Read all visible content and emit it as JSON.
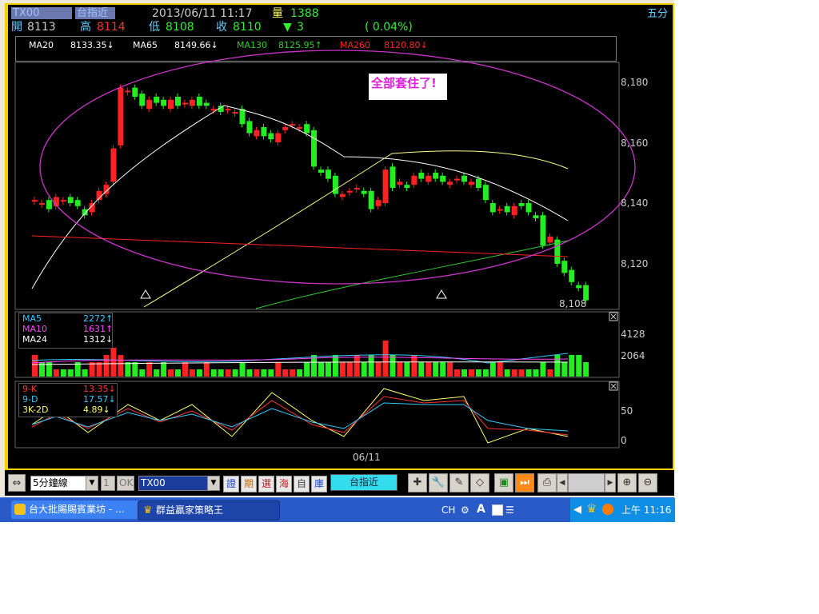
{
  "header": {
    "symbol": "TX00",
    "name": "台指近",
    "datetime": "2013/06/11 11:17",
    "vol_label": "量",
    "vol_value": "1388",
    "timeframe": "五分",
    "open_label": "開",
    "open_value": "8113",
    "high_label": "高",
    "high_value": "8114",
    "low_label": "低",
    "low_value": "8108",
    "close_label": "收",
    "close_value": "8110",
    "change_arrow": "▼",
    "change_value": "3",
    "change_pct": "( 0.04%)"
  },
  "ma_legend": [
    {
      "label": "MA20",
      "value": "8133.35↓",
      "color": "#ffffff"
    },
    {
      "label": "MA65",
      "value": "8149.66↓",
      "color": "#ffffff"
    },
    {
      "label": "MA130",
      "value": "8125.95↑",
      "color": "#33cc33"
    },
    {
      "label": "MA260",
      "value": "8120.80↓",
      "color": "#ff2222"
    }
  ],
  "annotation": "全部套住了!",
  "price_axis": [
    "8,180",
    "8,160",
    "8,140",
    "8,120"
  ],
  "last_price": "8,108",
  "volume_legend": [
    {
      "label": "MA5",
      "value": "2272↑",
      "color": "#33ccff"
    },
    {
      "label": "MA10",
      "value": "1631↑",
      "color": "#ff44ff"
    },
    {
      "label": "MA24",
      "value": "1312↓",
      "color": "#ffffff"
    }
  ],
  "volume_axis": [
    "4128",
    "2064"
  ],
  "kd_legend": [
    {
      "label": "9-K",
      "value": "13.35↓",
      "color": "#ff3333"
    },
    {
      "label": "9-D",
      "value": "17.57↓",
      "color": "#33ccff"
    },
    {
      "label": "3K-2D",
      "value": "4.89↓",
      "color": "#ffff66"
    }
  ],
  "kd_axis": [
    "50",
    "0"
  ],
  "x_label": "06/11",
  "toolbar": {
    "period": "5分鐘線",
    "count": "1",
    "ok": "OK",
    "symbol_input": "TX00",
    "cat_buttons": [
      "證",
      "期",
      "選",
      "海",
      "自",
      "庫"
    ],
    "name_display": "台指近"
  },
  "taskbar": {
    "tasks": [
      "台大批賜賜賓業坊 - ...",
      "群益贏家策略王"
    ],
    "ime": "CH",
    "clock": "上午 11:16"
  },
  "colors": {
    "up": "#ff2222",
    "down": "#22ee22",
    "accent": "#cc33cc"
  }
}
